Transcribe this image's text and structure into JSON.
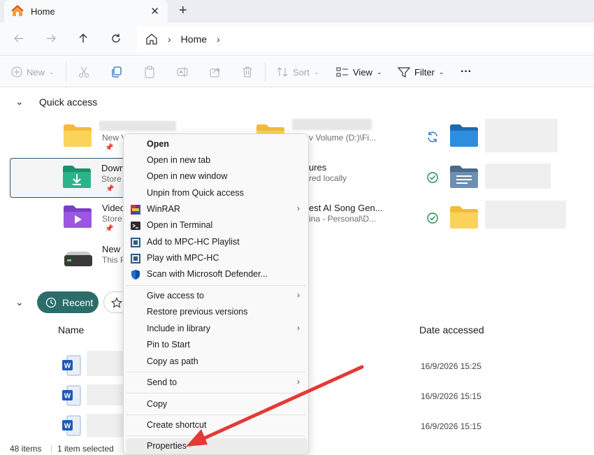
{
  "window": {
    "tab_title": "Home",
    "tab_close": "✕",
    "new_tab": "+"
  },
  "address": {
    "breadcrumb": "Home"
  },
  "toolbar": {
    "new_label": "New",
    "sort_label": "Sort",
    "view_label": "View",
    "filter_label": "Filter",
    "more_label": "···"
  },
  "quick_access": {
    "title": "Quick access",
    "items": [
      {
        "name": "",
        "sub": "New V",
        "pinned": true,
        "icon": "folder-icon"
      },
      {
        "name": "Down",
        "sub": "Store",
        "pinned": true,
        "icon": "downloads-folder-icon"
      },
      {
        "name": "Video",
        "sub": "Store",
        "pinned": true,
        "icon": "videos-folder-icon"
      },
      {
        "name": "New V",
        "sub": "This P",
        "pinned": false,
        "icon": "drive-icon"
      },
      {
        "name": "",
        "sub": "v Volume (D:)\\Fi...",
        "pinned": false,
        "icon": "folder-icon"
      },
      {
        "name": "ures",
        "sub": "red locally",
        "pinned": false,
        "icon": "pictures-folder-icon"
      },
      {
        "name": "est AI Song Gen...",
        "sub": "ina - Personal\\D...",
        "pinned": false,
        "icon": "folder-icon"
      }
    ]
  },
  "recent": {
    "chip_label": "Recent",
    "col_name": "Name",
    "col_date": "Date accessed",
    "rows": [
      {
        "date": "16/9/2026 15:25"
      },
      {
        "date": "16/9/2026 15:15"
      },
      {
        "date": "16/9/2026 15:15"
      }
    ]
  },
  "status": {
    "items_count": "48 items",
    "selected": "1 item selected"
  },
  "context_menu": {
    "open": "Open",
    "open_new_tab": "Open in new tab",
    "open_new_window": "Open in new window",
    "unpin": "Unpin from Quick access",
    "winrar": "WinRAR",
    "open_terminal": "Open in Terminal",
    "add_mpc": "Add to MPC-HC Playlist",
    "play_mpc": "Play with MPC-HC",
    "defender": "Scan with Microsoft Defender...",
    "give_access": "Give access to",
    "restore": "Restore previous versions",
    "include_library": "Include in library",
    "pin_start": "Pin to Start",
    "copy_path": "Copy as path",
    "send_to": "Send to",
    "copy": "Copy",
    "create_shortcut": "Create shortcut",
    "properties": "Properties"
  },
  "colors": {
    "accent": "#2b6d6a",
    "annotation_arrow": "#e53935",
    "folder_yellow": "#f6c744",
    "selection_border": "#2a5273"
  }
}
